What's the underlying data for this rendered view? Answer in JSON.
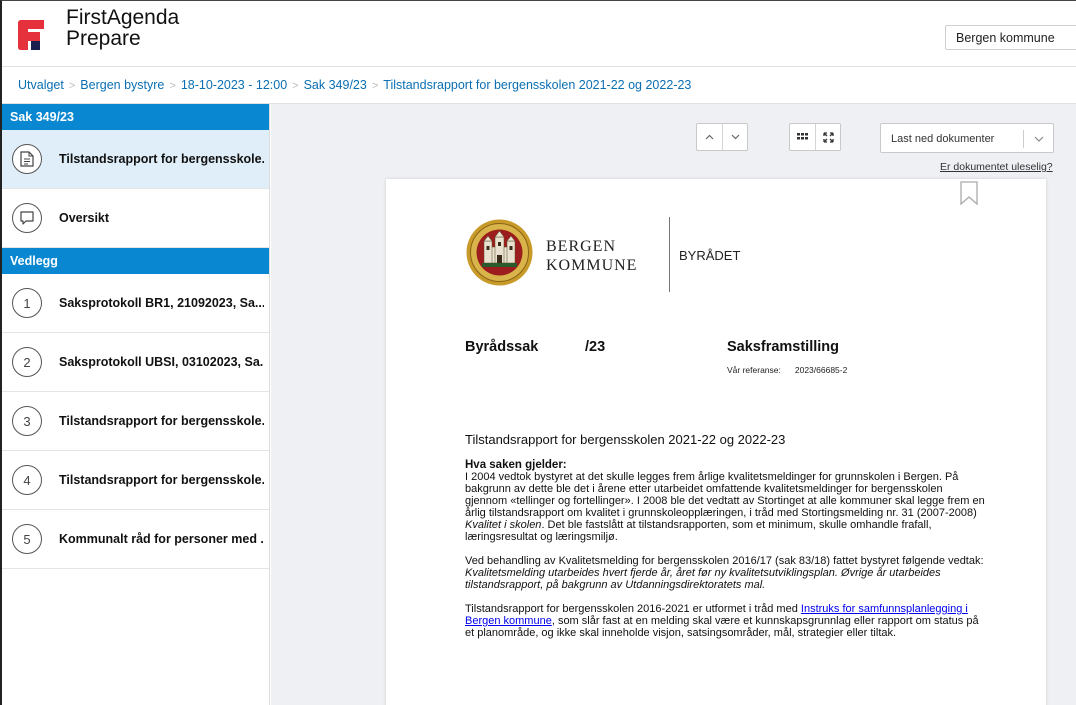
{
  "app": {
    "brand_line1": "FirstAgenda",
    "brand_line2": "Prepare",
    "brand_red": "#e5313b",
    "brand_navy": "#1a1f4d"
  },
  "org_select": {
    "value": "Bergen kommune"
  },
  "breadcrumb": [
    {
      "label": "Utvalget"
    },
    {
      "label": "Bergen bystyre"
    },
    {
      "label": "18-10-2023 - 12:00"
    },
    {
      "label": "Sak 349/23"
    },
    {
      "label": "Tilstandsrapport for bergensskolen 2021-22 og 2022-23"
    }
  ],
  "sidebar": {
    "case_header": "Sak 349/23",
    "case_items": [
      {
        "label": "Tilstandsrapport for bergensskole...",
        "icon": "document-icon"
      },
      {
        "label": "Oversikt",
        "icon": "speech-bubble-icon"
      }
    ],
    "attachments_header": "Vedlegg",
    "attachments": [
      {
        "number": "1",
        "label": "Saksprotokoll BR1, 21092023, Sa..."
      },
      {
        "number": "2",
        "label": "Saksprotokoll UBSI, 03102023, Sa..."
      },
      {
        "number": "3",
        "label": "Tilstandsrapport for bergensskole..."
      },
      {
        "number": "4",
        "label": "Tilstandsrapport for bergensskole..."
      },
      {
        "number": "5",
        "label": "Kommunalt råd for personer med ..."
      }
    ]
  },
  "toolbar": {
    "download_label": "Last ned dokumenter",
    "unreadable_link": "Er dokumentet uleselig?"
  },
  "document": {
    "org_line1": "BERGEN",
    "org_line2": "KOMMUNE",
    "department": "BYRÅDET",
    "case_type": "Byrådssak",
    "case_number": "/23",
    "doc_type": "Saksframstilling",
    "ref_label": "Vår referanse:",
    "ref_value": "2023/66685-2",
    "title": "Tilstandsrapport for bergensskolen 2021-22 og 2022-23",
    "section_heading": "Hva saken gjelder:",
    "p1_a": "I 2004 vedtok bystyret at det skulle legges frem årlige kvalitetsmeldinger for grunnskolen i Bergen. På bakgrunn av dette ble det i årene etter utarbeidet omfattende kvalitetsmeldinger for bergensskolen gjennom «tellinger og fortellinger». I 2008 ble det vedtatt av Stortinget at alle kommuner skal legge frem en årlig tilstandsrapport om kvalitet i grunnskoleopplæringen, i tråd med Stortingsmelding nr. 31 (2007-2008) ",
    "p1_italic": "Kvalitet i skolen",
    "p1_b": ". Det ble fastslått at tilstandsrapporten, som et minimum, skulle omhandle frafall, læringsresultat og læringsmiljø.",
    "p2_a": "Ved behandling av Kvalitetsmelding for bergensskolen 2016/17 (sak 83/18) fattet bystyret følgende vedtak: ",
    "p2_italic": "Kvalitetsmelding utarbeides hvert fjerde år, året før ny kvalitetsutviklingsplan. Øvrige år utarbeides tilstandsrapport, på bakgrunn av Utdanningsdirektoratets mal.",
    "p3_a": "Tilstandsrapport for bergensskolen 2016-2021 er utformet i tråd med ",
    "p3_link": "Instruks for samfunnsplanlegging i Bergen kommune",
    "p3_b": ", som slår fast at en melding skal være et kunnskapsgrunnlag eller rapport om status på et planområde, og ikke skal inneholde visjon, satsingsområder, mål, strategier eller tiltak."
  }
}
